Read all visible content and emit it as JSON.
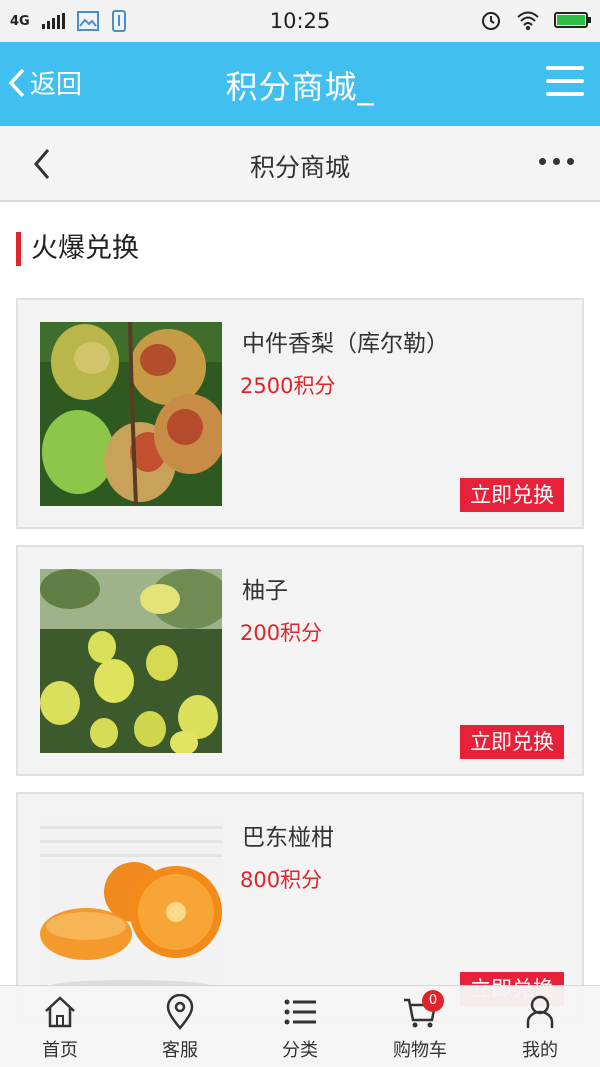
{
  "status_bar": {
    "network": "4G",
    "time": "10:25"
  },
  "app_header": {
    "back_label": "返回",
    "title": "积分商城_"
  },
  "sub_header": {
    "title": "积分商城"
  },
  "section": {
    "title": "火爆兑换"
  },
  "products": [
    {
      "name": "中件香梨（库尔勒）",
      "price": "2500积分",
      "button": "立即兑换",
      "image": "pear-photo"
    },
    {
      "name": "柚子",
      "price": "200积分",
      "button": "立即兑换",
      "image": "pomelo-photo"
    },
    {
      "name": "巴东椪柑",
      "price": "800积分",
      "button": "立即兑换",
      "image": "orange-photo"
    }
  ],
  "bottom_nav": {
    "items": [
      {
        "label": "首页",
        "icon": "home-icon"
      },
      {
        "label": "客服",
        "icon": "location-pin-icon"
      },
      {
        "label": "分类",
        "icon": "list-icon"
      },
      {
        "label": "购物车",
        "icon": "cart-icon"
      },
      {
        "label": "我的",
        "icon": "user-icon"
      }
    ],
    "cart_badge": "0"
  },
  "colors": {
    "accent_blue": "#41bff0",
    "accent_red": "#e0242b",
    "button_red": "#e8213a"
  }
}
